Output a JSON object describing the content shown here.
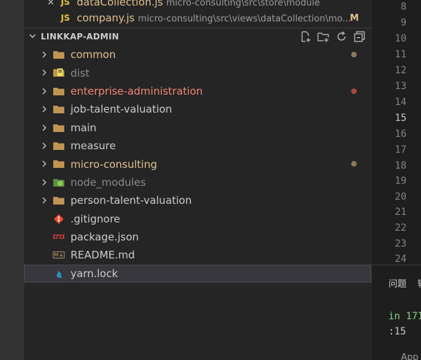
{
  "open_editors": [
    {
      "close_glyph": "×",
      "lang_badge": "JS",
      "name": "dataCollection.js",
      "path": "micro-consulting\\src\\store\\module",
      "flag": ""
    },
    {
      "close_glyph": "",
      "lang_badge": "JS",
      "name": "company.js",
      "path": "micro-consulting\\src\\views\\dataCollection\\mo...",
      "flag": "M"
    }
  ],
  "explorer": {
    "title": "LINKKAP-ADMIN",
    "actions": [
      "new-file-icon",
      "new-folder-icon",
      "refresh-icon",
      "collapse-all-icon"
    ],
    "items": [
      {
        "label": "common",
        "kind": "folder",
        "icon": "folder-icon",
        "color": "#e2c08d",
        "dot": "#8c7a5e"
      },
      {
        "label": "dist",
        "kind": "folder",
        "icon": "folder-dist-icon",
        "color": "#8b8b8b",
        "dot": ""
      },
      {
        "label": "enterprise-administration",
        "kind": "folder",
        "icon": "folder-icon",
        "color": "#f48771",
        "dot": "#a24b45"
      },
      {
        "label": "job-talent-valuation",
        "kind": "folder",
        "icon": "folder-icon",
        "color": "#cccccc",
        "dot": ""
      },
      {
        "label": "main",
        "kind": "folder",
        "icon": "folder-icon",
        "color": "#cccccc",
        "dot": ""
      },
      {
        "label": "measure",
        "kind": "folder",
        "icon": "folder-icon",
        "color": "#cccccc",
        "dot": ""
      },
      {
        "label": "micro-consulting",
        "kind": "folder",
        "icon": "folder-icon",
        "color": "#e2c08d",
        "dot": "#8c7a5e"
      },
      {
        "label": "node_modules",
        "kind": "folder",
        "icon": "folder-node-icon",
        "color": "#8b8b8b",
        "dot": ""
      },
      {
        "label": "person-talent-valuation",
        "kind": "folder",
        "icon": "folder-icon",
        "color": "#cccccc",
        "dot": ""
      },
      {
        "label": ".gitignore",
        "kind": "file",
        "icon": "git-icon",
        "color": "#cccccc",
        "dot": ""
      },
      {
        "label": "package.json",
        "kind": "file",
        "icon": "npm-icon",
        "color": "#cccccc",
        "dot": ""
      },
      {
        "label": "README.md",
        "kind": "file",
        "icon": "markdown-icon",
        "color": "#cccccc",
        "dot": ""
      },
      {
        "label": "yarn.lock",
        "kind": "file",
        "icon": "yarn-icon",
        "color": "#cccccc",
        "dot": "",
        "selected": true
      }
    ]
  },
  "editor": {
    "line_numbers": [
      "8",
      "9",
      "10",
      "11",
      "12",
      "13",
      "14",
      "15",
      "16",
      "17",
      "18",
      "19",
      "20",
      "21",
      "22",
      "23",
      "24"
    ],
    "active_line": "15"
  },
  "panel": {
    "tab_problems": "问题",
    "tab_next": "输",
    "terminal_line1": "in 171",
    "terminal_line2": ":15",
    "terminal_line3": "App"
  },
  "colors": {
    "sidebar_bg": "#252526",
    "selection_bg": "#37373d",
    "folder": "#c09553",
    "modified": "#e2c08d",
    "error": "#f48771"
  }
}
